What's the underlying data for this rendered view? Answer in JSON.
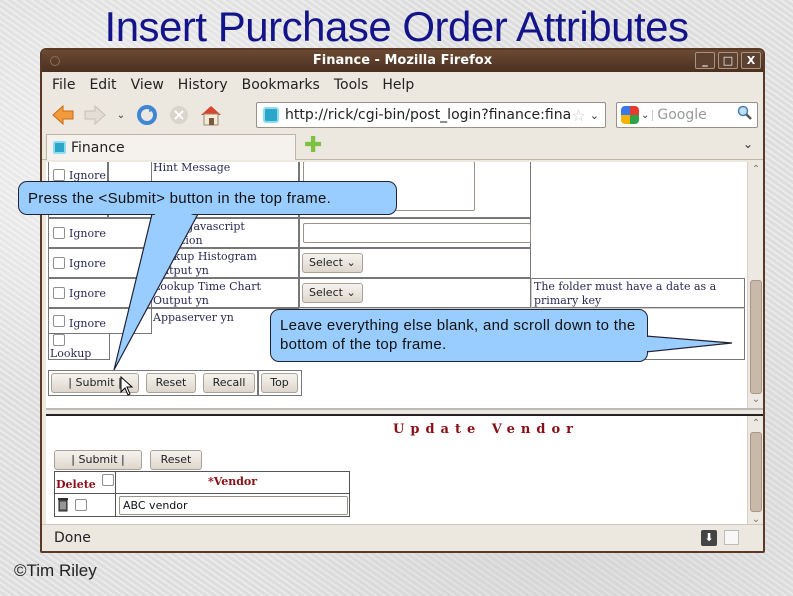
{
  "slide": {
    "title": "Insert Purchase Order Attributes",
    "credit": "©Tim Riley"
  },
  "window": {
    "title": "Finance - Mozilla Firefox",
    "controls": [
      "_",
      "□",
      "X"
    ]
  },
  "menu": [
    "File",
    "Edit",
    "View",
    "History",
    "Bookmarks",
    "Tools",
    "Help"
  ],
  "navbar": {
    "url": "http://rick/cgi-bin/post_login?finance:financ",
    "search_placeholder": "Google",
    "icons": [
      "back-arrow-icon",
      "forward-arrow-icon",
      "history-dropdown-icon",
      "reload-icon",
      "stop-icon",
      "home-icon"
    ]
  },
  "tabs": {
    "active": "Finance"
  },
  "top_frame": {
    "rows": [
      {
        "ignore": "Ignore",
        "label": "Hint Message",
        "input": "textarea"
      },
      {
        "ignore": "Ignore",
        "label": "Focus Javascript Function",
        "input": "text"
      },
      {
        "ignore": "Ignore",
        "label": "Lookup Histogram Output yn",
        "input": "select",
        "select_value": "Select"
      },
      {
        "ignore": "Ignore",
        "label": "Lookup Time Chart Output yn",
        "input": "select",
        "select_value": "Select",
        "note": "The folder must have a date as a primary key"
      },
      {
        "ignore": "Ignore",
        "label": "Appaserver yn",
        "input": "none"
      }
    ],
    "lookup_label": "Lookup",
    "buttons": {
      "submit": "|   Submit   |",
      "reset": "Reset",
      "recall": "Recall",
      "top": "Top"
    }
  },
  "bottom_frame": {
    "title": "Update Vendor",
    "buttons": {
      "submit": "|   Submit   |",
      "reset": "Reset"
    },
    "table": {
      "headers": {
        "delete": "Delete",
        "vendor": "*Vendor"
      },
      "rows": [
        {
          "vendor": "ABC vendor"
        }
      ]
    }
  },
  "status": {
    "text": "Done"
  },
  "callouts": {
    "submit": "Press the <Submit> button in the top frame.",
    "scroll": "Leave everything else blank, and scroll down to the bottom of the top frame."
  }
}
